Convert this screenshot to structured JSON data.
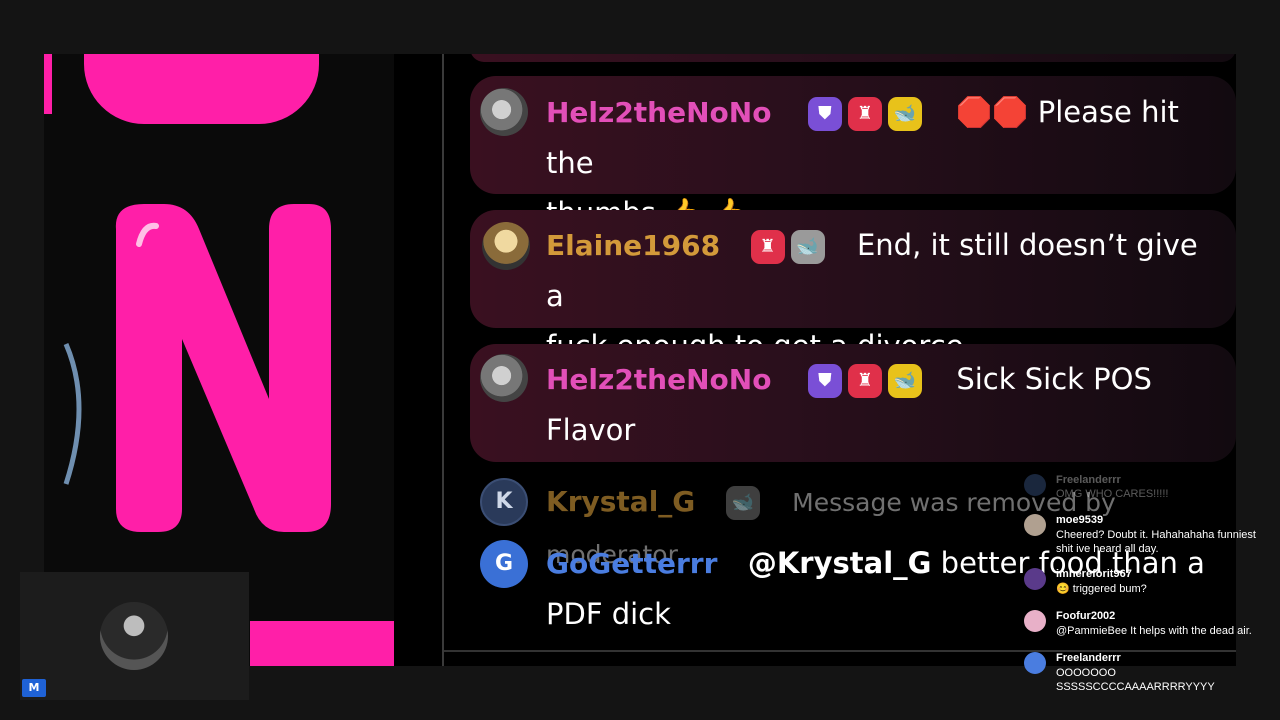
{
  "chat": {
    "messages": [
      {
        "user": "Helz2theNoNo",
        "user_color": "#e24fb8",
        "badges": [
          "shield-badge",
          "moderator-badge",
          "whale-badge"
        ],
        "text_line1": "🛑🛑 Please hit the",
        "text_line2": "thumbs 👍 👍"
      },
      {
        "user": "Elaine1968",
        "user_color": "#d39a3a",
        "badges": [
          "moderator-badge",
          "whale-badge"
        ],
        "text_line1": "End, it still doesn’t give a",
        "text_line2": "fuck enough to get a divorce"
      },
      {
        "user": "Helz2theNoNo",
        "user_color": "#e24fb8",
        "badges": [
          "shield-badge",
          "moderator-badge",
          "whale-badge"
        ],
        "text_line1": "Sick Sick POS",
        "text_line2": "Flavor"
      },
      {
        "user": "Krystal_G",
        "user_color": "#8a6a3a",
        "avatar_letter": "K",
        "text": "Message was removed by moderator"
      },
      {
        "user": "GoGetterrr",
        "user_color": "#4a7de0",
        "avatar_letter": "G",
        "mention": "@Krystal_G",
        "text_line1": " better food than a",
        "text_line2": "PDF dick"
      }
    ]
  },
  "overlay": {
    "items": [
      {
        "name": "Freelanderrr",
        "text": "OMG WHO CARES!!!!!"
      },
      {
        "name": "moe9539",
        "text": "Cheered? Doubt it. Hahahahaha funniest shit ive heard all day."
      },
      {
        "name": "imhereforit967",
        "text": "😊 triggered bum?"
      },
      {
        "name": "Foofur2002",
        "text": "@PammieBee It helps with the dead air."
      },
      {
        "name": "Freelanderrr",
        "text": "OOOOOOO SSSSSCCCCAAAARRRRYYYY"
      }
    ]
  },
  "camera": {
    "badge": "M"
  },
  "colors": {
    "pink": "#ff1fa8",
    "shield": "#7a4fd6",
    "mod": "#e0304a",
    "whale": "#e8c21a",
    "grey_whale": "#9a9a9a"
  }
}
